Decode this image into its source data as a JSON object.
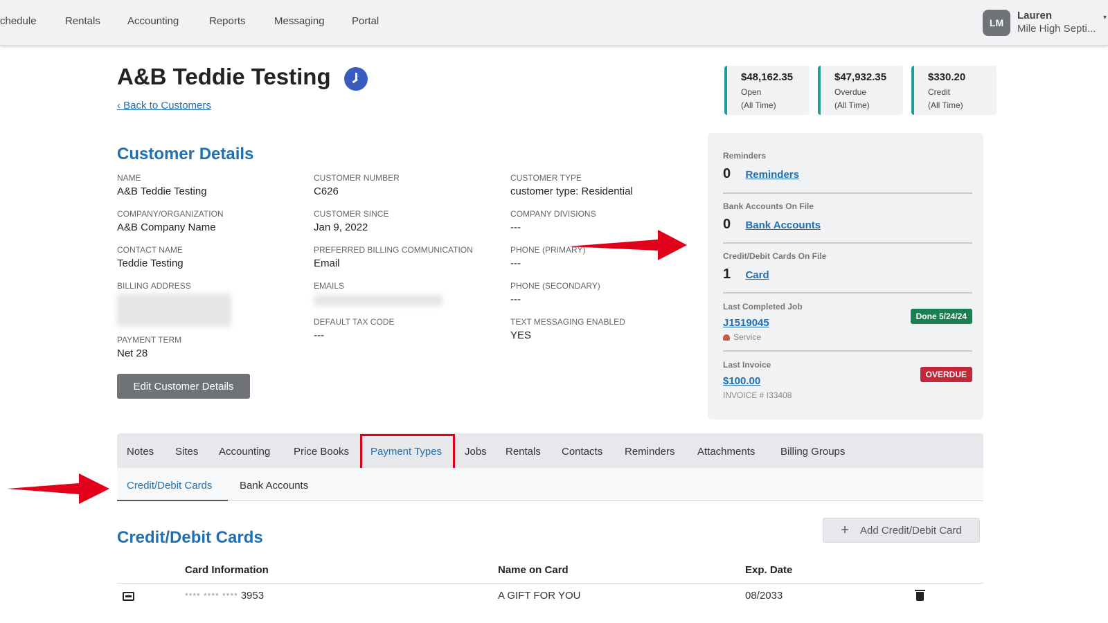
{
  "nav": {
    "items": [
      "chedule",
      "Rentals",
      "Accounting",
      "Reports",
      "Messaging",
      "Portal"
    ]
  },
  "user": {
    "initials": "LM",
    "name": "Lauren",
    "org": "Mile High Septi..."
  },
  "header": {
    "title": "A&B Teddie Testing",
    "back_link": "Back to Customers"
  },
  "summary": [
    {
      "amount": "$48,162.35",
      "label": "Open",
      "sub": "(All Time)"
    },
    {
      "amount": "$47,932.35",
      "label": "Overdue",
      "sub": "(All Time)"
    },
    {
      "amount": "$330.20",
      "label": "Credit",
      "sub": "(All Time)"
    }
  ],
  "details": {
    "title": "Customer Details",
    "fields": {
      "name": {
        "label": "NAME",
        "value": "A&B Teddie Testing"
      },
      "company": {
        "label": "COMPANY/ORGANIZATION",
        "value": "A&B Company Name"
      },
      "contact": {
        "label": "CONTACT NAME",
        "value": "Teddie Testing"
      },
      "billing_address": {
        "label": "BILLING ADDRESS"
      },
      "payment_term": {
        "label": "PAYMENT TERM",
        "value": "Net 28"
      },
      "customer_number": {
        "label": "CUSTOMER NUMBER",
        "value": "C626"
      },
      "customer_since": {
        "label": "CUSTOMER SINCE",
        "value": "Jan 9, 2022"
      },
      "billing_comm": {
        "label": "PREFERRED BILLING COMMUNICATION",
        "value": "Email"
      },
      "emails": {
        "label": "EMAILS"
      },
      "tax_code": {
        "label": "DEFAULT TAX CODE",
        "value": "---"
      },
      "customer_type": {
        "label": "CUSTOMER TYPE",
        "value": "customer type: Residential"
      },
      "divisions": {
        "label": "COMPANY DIVISIONS",
        "value": "---"
      },
      "phone_primary": {
        "label": "PHONE (PRIMARY)",
        "value": "---"
      },
      "phone_secondary": {
        "label": "PHONE (SECONDARY)",
        "value": "---"
      },
      "text_messaging": {
        "label": "TEXT MESSAGING ENABLED",
        "value": "YES"
      }
    },
    "edit_button": "Edit Customer Details"
  },
  "info": {
    "reminders": {
      "label": "Reminders",
      "count": "0",
      "link": "Reminders"
    },
    "bank": {
      "label": "Bank Accounts On File",
      "count": "0",
      "link": "Bank Accounts"
    },
    "cards": {
      "label": "Credit/Debit Cards On File",
      "count": "1",
      "link": "Card"
    },
    "last_job": {
      "label": "Last Completed Job",
      "link": "J1519045",
      "sub": "Service",
      "badge": "Done 5/24/24"
    },
    "last_invoice": {
      "label": "Last Invoice",
      "link": "$100.00",
      "sub": "INVOICE # I33408",
      "badge": "OVERDUE"
    }
  },
  "tabs": [
    "Notes",
    "Sites",
    "Accounting",
    "Price Books",
    "Payment Types",
    "Jobs",
    "Rentals",
    "Contacts",
    "Reminders",
    "Attachments",
    "Billing Groups"
  ],
  "subtabs": [
    "Credit/Debit Cards",
    "Bank Accounts"
  ],
  "cards_section": {
    "title": "Credit/Debit Cards",
    "add_button": "Add Credit/Debit Card",
    "columns": [
      "Card Information",
      "Name on Card",
      "Exp. Date"
    ],
    "rows": [
      {
        "masked": "**** **** ****",
        "last4": "3953",
        "name": "A GIFT FOR YOU",
        "exp": "08/2033"
      }
    ]
  },
  "colors": {
    "accent": "#1f6fb2",
    "summary_border": "#1e9b9b",
    "done": "#1b7f52",
    "overdue": "#c3273a",
    "annotation": "#e0001a"
  }
}
